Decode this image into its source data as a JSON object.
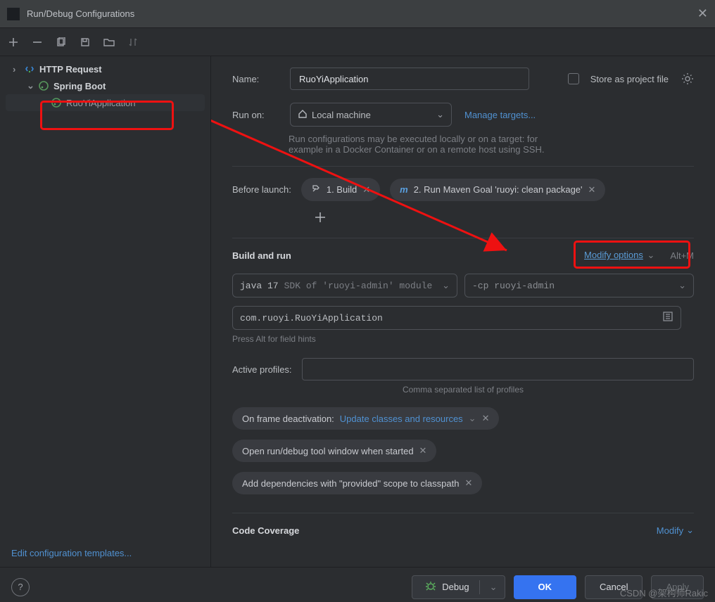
{
  "titlebar": {
    "title": "Run/Debug Configurations"
  },
  "tree": {
    "http": {
      "label": "HTTP Request"
    },
    "spring": {
      "label": "Spring Boot"
    },
    "app": {
      "label": "RuoYiApplication"
    }
  },
  "name": {
    "label": "Name:",
    "value": "RuoYiApplication"
  },
  "store": {
    "label": "Store as project file"
  },
  "runon": {
    "label": "Run on:",
    "value": "Local machine",
    "manage": "Manage targets...",
    "desc1": "Run configurations may be executed locally or on a target: for",
    "desc2": "example in a Docker Container or on a remote host using SSH."
  },
  "before": {
    "label": "Before launch:",
    "task1": "1. Build",
    "task2": "2. Run Maven Goal 'ruoyi: clean package'"
  },
  "build": {
    "header": "Build and run",
    "modify": "Modify options",
    "shortcut": "Alt+M",
    "sdk_prefix": "java 17",
    "sdk_suffix": "SDK of 'ruoyi-admin' module",
    "cp": "-cp ruoyi-admin",
    "mainclass": "com.ruoyi.RuoYiApplication",
    "hint": "Press Alt for field hints"
  },
  "profiles": {
    "label": "Active profiles:",
    "hint": "Comma separated list of profiles"
  },
  "opts": {
    "frame_label": "On frame deactivation:",
    "frame_value": "Update classes and resources",
    "open_tool": "Open run/debug tool window when started",
    "provided": "Add dependencies with \"provided\" scope to classpath"
  },
  "coverage": {
    "header": "Code Coverage",
    "modify": "Modify"
  },
  "templates": {
    "label": "Edit configuration templates..."
  },
  "footer": {
    "debug": "Debug",
    "ok": "OK",
    "cancel": "Cancel",
    "apply": "Apply"
  },
  "watermark": "CSDN @架构师Rakic"
}
